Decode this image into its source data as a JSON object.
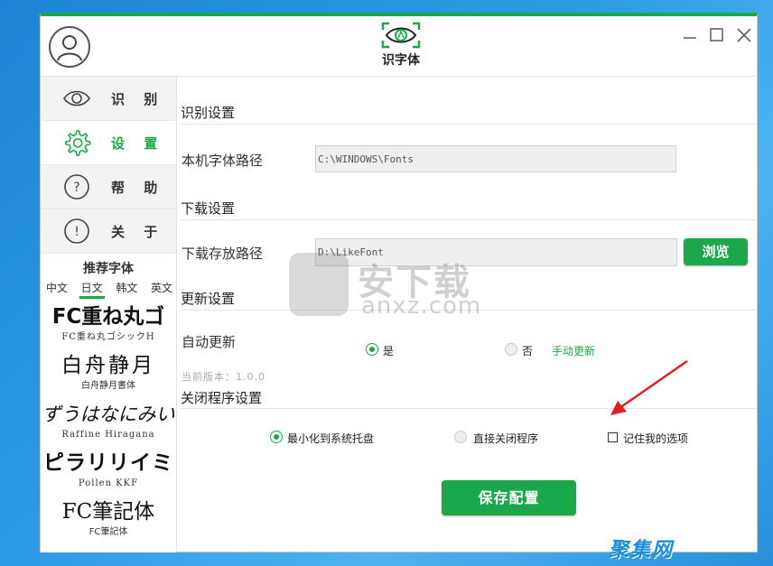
{
  "app": {
    "title": "识字体"
  },
  "sidebar": {
    "items": [
      {
        "label": "识 别",
        "icon": "eye-icon"
      },
      {
        "label": "设 置",
        "icon": "gear-icon"
      },
      {
        "label": "帮 助",
        "icon": "question-icon"
      },
      {
        "label": "关 于",
        "icon": "info-icon"
      }
    ],
    "recommend_title": "推荐字体",
    "tabs": [
      "中文",
      "日文",
      "韩文",
      "英文"
    ],
    "active_tab": "日文",
    "fonts": [
      {
        "sample": "FC重ね丸ゴ",
        "name": "FC重ね丸ゴシックH"
      },
      {
        "sample": "白舟静月",
        "name": "白舟静月書体"
      },
      {
        "sample": "ずうはなにみい",
        "name": "Raffine Hiragana"
      },
      {
        "sample": "ピラリリイミ",
        "name": "Pollen KKF"
      },
      {
        "sample": "FC筆記体",
        "name": "FC筆記体"
      }
    ]
  },
  "settings": {
    "recognize": {
      "title": "识别设置",
      "font_path_label": "本机字体路径",
      "font_path_value": "C:\\WINDOWS\\Fonts"
    },
    "download": {
      "title": "下载设置",
      "path_label": "下载存放路径",
      "path_value": "D:\\LikeFont",
      "browse_label": "浏览"
    },
    "update": {
      "title": "更新设置",
      "auto_label": "自动更新",
      "yes_label": "是",
      "no_label": "否",
      "auto_update": true,
      "manual_label": "手动更新",
      "version_text": "当前版本：1.0.0"
    },
    "close": {
      "title": "关闭程序设置",
      "minimize_label": "最小化到系统托盘",
      "exit_label": "直接关闭程序",
      "remember_label": "记住我的选项",
      "selected": "minimize",
      "remember": false
    },
    "save_label": "保存配置"
  },
  "watermark": {
    "main": "安下载",
    "sub": "anxz.com",
    "corner": "聚集网"
  },
  "colors": {
    "accent": "#1aa84a",
    "annotation_arrow": "#e02020"
  }
}
